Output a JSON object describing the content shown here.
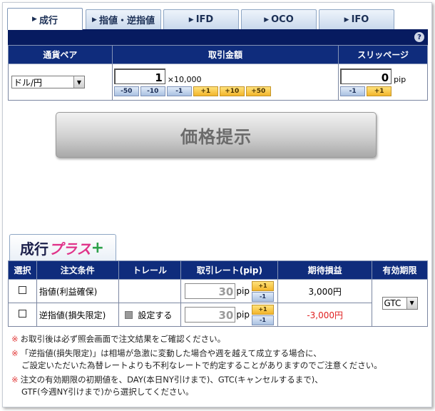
{
  "tabs": [
    {
      "label": "成行"
    },
    {
      "label": "指値・逆指値"
    },
    {
      "label": "IFD"
    },
    {
      "label": "OCO"
    },
    {
      "label": "IFO"
    }
  ],
  "order": {
    "headers": {
      "pair": "通貨ペア",
      "amount": "取引金額",
      "slippage": "スリッページ"
    },
    "pair_value": "ドル/円",
    "amount_value": "1",
    "amount_unit": "×10,000",
    "amount_buttons": [
      "-50",
      "-10",
      "-1",
      "+1",
      "+10",
      "+50"
    ],
    "slippage_value": "0",
    "slippage_unit": "pip",
    "slippage_buttons": [
      "-1",
      "+1"
    ]
  },
  "price_button": "価格提示",
  "plus": {
    "tab_text1": "成行",
    "tab_text2": "プラス",
    "tab_text3": "+",
    "headers": [
      "選択",
      "注文条件",
      "トレール",
      "取引レート(pip)",
      "期待損益",
      "有効期限"
    ],
    "rows": [
      {
        "condition": "指値(利益確保)",
        "trail": "",
        "rate": "30",
        "unit": "pip",
        "up": "+1",
        "down": "-1",
        "pnl": "3,000円",
        "pnl_color": "#000000"
      },
      {
        "condition": "逆指値(損失限定)",
        "trail": "設定する",
        "rate": "30",
        "unit": "pip",
        "up": "+1",
        "down": "-1",
        "pnl": "-3,000円",
        "pnl_color": "#e02020"
      }
    ],
    "expiry_value": "GTC"
  },
  "notes": {
    "mark": "※",
    "n1": "お取引後は必ず照会画面で注文結果をご確認ください。",
    "n2a": "「逆指値(損失限定)」は相場が急激に変動した場合や週を越えて成立する場合に、",
    "n2b": "ご設定いただいた為替レートよりも不利なレートで約定することがありますのでご注意ください。",
    "n3a": "注文の有効期限の初期値を、DAY(本日NY引けまで)、GTC(キャンセルするまで)、",
    "n3b": "GTF(今週NY引けまで)から選択してください。"
  },
  "colors": {
    "navy": "#0f2c7c",
    "accent_orange": "#f3b52b",
    "loss_red": "#e02020"
  }
}
